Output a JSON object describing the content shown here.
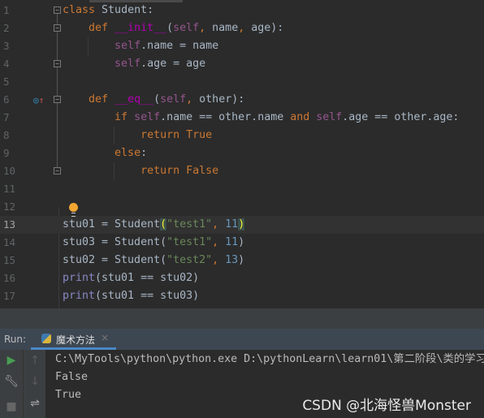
{
  "editor": {
    "current_line": 13,
    "lines": [
      {
        "n": "1",
        "tokens": [
          [
            "kw",
            "class "
          ],
          [
            "",
            "Student:"
          ]
        ]
      },
      {
        "n": "2",
        "tokens": [
          [
            "",
            "    "
          ],
          [
            "kw",
            "def "
          ],
          [
            "fn",
            "__init__"
          ],
          [
            "",
            "("
          ],
          [
            "self",
            "self"
          ],
          [
            "kw",
            ", "
          ],
          [
            "",
            "name"
          ],
          [
            "kw",
            ", "
          ],
          [
            "",
            "age):"
          ]
        ]
      },
      {
        "n": "3",
        "tokens": [
          [
            "",
            "        "
          ],
          [
            "self",
            "self"
          ],
          [
            "",
            ".name = name"
          ]
        ]
      },
      {
        "n": "4",
        "tokens": [
          [
            "",
            "        "
          ],
          [
            "self",
            "self"
          ],
          [
            "",
            ".age = age"
          ]
        ]
      },
      {
        "n": "5",
        "tokens": []
      },
      {
        "n": "6",
        "tokens": [
          [
            "",
            "    "
          ],
          [
            "kw",
            "def "
          ],
          [
            "fn",
            "__eq__"
          ],
          [
            "",
            "("
          ],
          [
            "self",
            "self"
          ],
          [
            "kw",
            ", "
          ],
          [
            "",
            "other):"
          ]
        ]
      },
      {
        "n": "7",
        "tokens": [
          [
            "",
            "        "
          ],
          [
            "kw",
            "if "
          ],
          [
            "self",
            "self"
          ],
          [
            "",
            ".name == other.name "
          ],
          [
            "kw",
            "and "
          ],
          [
            "self",
            "self"
          ],
          [
            "",
            ".age == other.age:"
          ]
        ]
      },
      {
        "n": "8",
        "tokens": [
          [
            "",
            "            "
          ],
          [
            "kw",
            "return "
          ],
          [
            "kw",
            "True"
          ]
        ]
      },
      {
        "n": "9",
        "tokens": [
          [
            "",
            "        "
          ],
          [
            "kw",
            "else"
          ],
          [
            "",
            ":"
          ]
        ]
      },
      {
        "n": "10",
        "tokens": [
          [
            "",
            "            "
          ],
          [
            "kw",
            "return "
          ],
          [
            "kw",
            "False"
          ]
        ]
      },
      {
        "n": "11",
        "tokens": []
      },
      {
        "n": "12",
        "tokens": []
      },
      {
        "n": "13",
        "tokens": [
          [
            "",
            "stu01 = Student"
          ],
          [
            "br",
            "("
          ],
          [
            "str",
            "\"test1\""
          ],
          [
            "kw",
            ", "
          ],
          [
            "num",
            "11"
          ],
          [
            "br",
            ")"
          ]
        ]
      },
      {
        "n": "14",
        "tokens": [
          [
            "",
            "stu03 = Student("
          ],
          [
            "str",
            "\"test1\""
          ],
          [
            "kw",
            ", "
          ],
          [
            "num",
            "11"
          ],
          [
            "",
            ")"
          ]
        ]
      },
      {
        "n": "15",
        "tokens": [
          [
            "",
            "stu02 = Student("
          ],
          [
            "str",
            "\"test2\""
          ],
          [
            "kw",
            ", "
          ],
          [
            "num",
            "13"
          ],
          [
            "",
            ")"
          ]
        ]
      },
      {
        "n": "16",
        "tokens": [
          [
            "bi",
            "print"
          ],
          [
            "",
            "(stu01 == stu02)"
          ]
        ]
      },
      {
        "n": "17",
        "tokens": [
          [
            "bi",
            "print"
          ],
          [
            "",
            "(stu01 == stu03)"
          ]
        ]
      }
    ]
  },
  "run": {
    "label": "Run:",
    "tab": "魔术方法",
    "output": [
      "C:\\MyTools\\python\\python.exe D:\\pythonLearn\\learn01\\第二阶段\\类的学习",
      "False",
      "True"
    ]
  },
  "watermark": "CSDN @北海怪兽Monster"
}
